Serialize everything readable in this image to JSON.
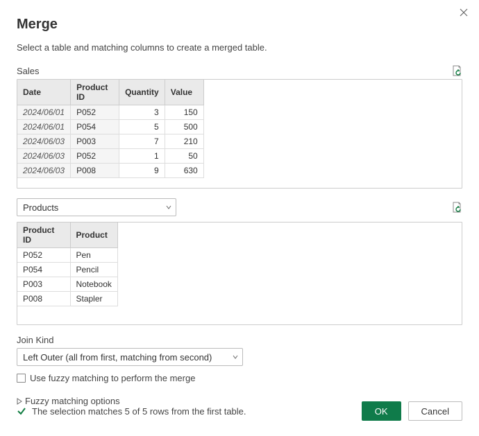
{
  "dialog": {
    "title": "Merge",
    "subtitle": "Select a table and matching columns to create a merged table."
  },
  "first_table": {
    "name": "Sales",
    "columns": [
      "Date",
      "Product ID",
      "Quantity",
      "Value"
    ],
    "rows": [
      {
        "date": "2024/06/01",
        "product_id": "P052",
        "quantity": 3,
        "value": 150
      },
      {
        "date": "2024/06/01",
        "product_id": "P054",
        "quantity": 5,
        "value": 500
      },
      {
        "date": "2024/06/03",
        "product_id": "P003",
        "quantity": 7,
        "value": 210
      },
      {
        "date": "2024/06/03",
        "product_id": "P052",
        "quantity": 1,
        "value": 50
      },
      {
        "date": "2024/06/03",
        "product_id": "P008",
        "quantity": 9,
        "value": 630
      }
    ]
  },
  "second_table": {
    "selected": "Products",
    "columns": [
      "Product ID",
      "Product"
    ],
    "rows": [
      {
        "product_id": "P052",
        "product": "Pen"
      },
      {
        "product_id": "P054",
        "product": "Pencil"
      },
      {
        "product_id": "P003",
        "product": "Notebook"
      },
      {
        "product_id": "P008",
        "product": "Stapler"
      }
    ]
  },
  "join": {
    "label": "Join Kind",
    "selected": "Left Outer (all from first, matching from second)"
  },
  "fuzzy": {
    "checkbox_label": "Use fuzzy matching to perform the merge",
    "options_label": "Fuzzy matching options"
  },
  "status": {
    "text": "The selection matches 5 of 5 rows from the first table."
  },
  "buttons": {
    "ok": "OK",
    "cancel": "Cancel"
  },
  "icons": {
    "close": "close-icon",
    "refresh": "refresh-icon",
    "chevron_down": "chevron-down-icon",
    "disclosure": "triangle-right-icon",
    "check": "check-icon"
  }
}
